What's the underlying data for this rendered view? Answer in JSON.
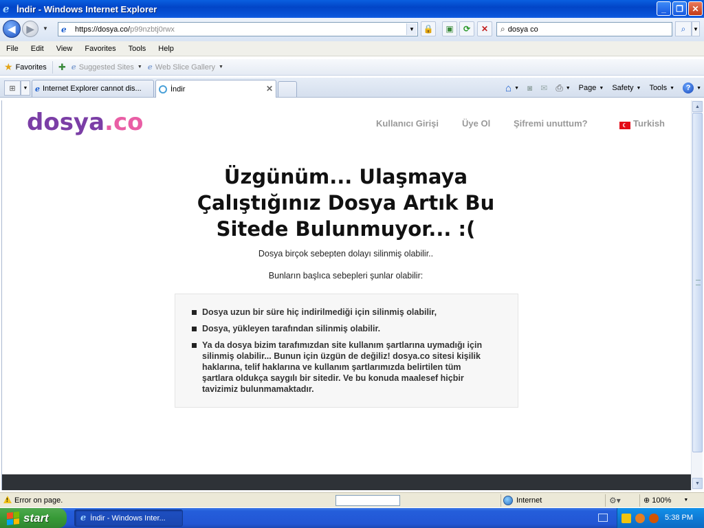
{
  "window": {
    "title": "İndir - Windows Internet Explorer",
    "minimize": "_",
    "restore": "❐",
    "close": "✕"
  },
  "address_bar": {
    "url_host": "https://dosya.co/",
    "url_path": "p99nzbtj0rwx"
  },
  "search": {
    "value": "dosya co"
  },
  "menu": [
    "File",
    "Edit",
    "View",
    "Favorites",
    "Tools",
    "Help"
  ],
  "favorites_bar": {
    "favorites_label": "Favorites",
    "links": [
      "Suggested Sites",
      "Web Slice Gallery"
    ]
  },
  "tabs": [
    {
      "label": "Internet Explorer cannot dis..."
    },
    {
      "label": "İndir"
    }
  ],
  "command_bar": {
    "page": "Page",
    "safety": "Safety",
    "tools": "Tools"
  },
  "site": {
    "logo_main": "dosya",
    "logo_dot": ".co",
    "nav": {
      "login": "Kullanıcı Girişi",
      "register": "Üye Ol",
      "forgot": "Şifremi unuttum?",
      "language": "Turkish"
    },
    "headline": "Üzgünüm... Ulaşmaya Çalıştığınız Dosya Artık Bu Sitede Bulunmuyor... :(",
    "subtitle1": "Dosya birçok sebepten dolayı silinmiş olabilir..",
    "subtitle2": "Bunların başlıca sebepleri şunlar olabilir:",
    "reasons": [
      "Dosya uzun bir süre hiç indirilmediği için silinmiş olabilir,",
      "Dosya, yükleyen tarafından silinmiş olabilir.",
      "Ya da dosya bizim tarafımızdan site kullanım şartlarına uymadığı için silinmiş olabilir... Bunun için üzgün de değiliz! dosya.co sitesi kişilik haklarına, telif haklarına ve kullanım şartlarımızda belirtilen tüm şartlara oldukça saygılı bir sitedir. Ve bu konuda maalesef hiçbir tavizimiz bulunmamaktadır."
    ]
  },
  "status_bar": {
    "error_text": "Error on page.",
    "zone": "Internet",
    "zoom": "100%"
  },
  "taskbar": {
    "start": "start",
    "task": "İndir - Windows Inter...",
    "clock": "5:38 PM"
  }
}
